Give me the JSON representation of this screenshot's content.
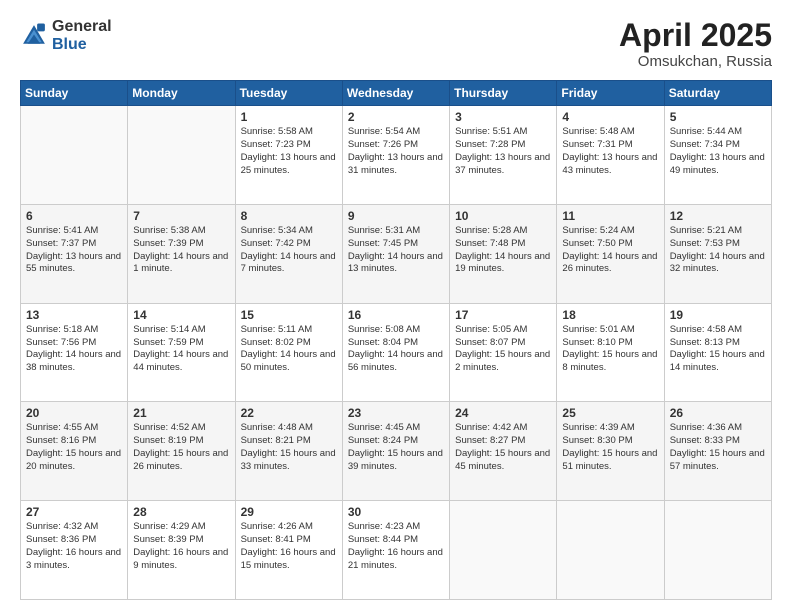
{
  "header": {
    "logo_general": "General",
    "logo_blue": "Blue",
    "title": "April 2025",
    "location": "Omsukchan, Russia"
  },
  "calendar": {
    "days_of_week": [
      "Sunday",
      "Monday",
      "Tuesday",
      "Wednesday",
      "Thursday",
      "Friday",
      "Saturday"
    ],
    "weeks": [
      [
        {
          "day": "",
          "info": ""
        },
        {
          "day": "",
          "info": ""
        },
        {
          "day": "1",
          "info": "Sunrise: 5:58 AM\nSunset: 7:23 PM\nDaylight: 13 hours and 25 minutes."
        },
        {
          "day": "2",
          "info": "Sunrise: 5:54 AM\nSunset: 7:26 PM\nDaylight: 13 hours and 31 minutes."
        },
        {
          "day": "3",
          "info": "Sunrise: 5:51 AM\nSunset: 7:28 PM\nDaylight: 13 hours and 37 minutes."
        },
        {
          "day": "4",
          "info": "Sunrise: 5:48 AM\nSunset: 7:31 PM\nDaylight: 13 hours and 43 minutes."
        },
        {
          "day": "5",
          "info": "Sunrise: 5:44 AM\nSunset: 7:34 PM\nDaylight: 13 hours and 49 minutes."
        }
      ],
      [
        {
          "day": "6",
          "info": "Sunrise: 5:41 AM\nSunset: 7:37 PM\nDaylight: 13 hours and 55 minutes."
        },
        {
          "day": "7",
          "info": "Sunrise: 5:38 AM\nSunset: 7:39 PM\nDaylight: 14 hours and 1 minute."
        },
        {
          "day": "8",
          "info": "Sunrise: 5:34 AM\nSunset: 7:42 PM\nDaylight: 14 hours and 7 minutes."
        },
        {
          "day": "9",
          "info": "Sunrise: 5:31 AM\nSunset: 7:45 PM\nDaylight: 14 hours and 13 minutes."
        },
        {
          "day": "10",
          "info": "Sunrise: 5:28 AM\nSunset: 7:48 PM\nDaylight: 14 hours and 19 minutes."
        },
        {
          "day": "11",
          "info": "Sunrise: 5:24 AM\nSunset: 7:50 PM\nDaylight: 14 hours and 26 minutes."
        },
        {
          "day": "12",
          "info": "Sunrise: 5:21 AM\nSunset: 7:53 PM\nDaylight: 14 hours and 32 minutes."
        }
      ],
      [
        {
          "day": "13",
          "info": "Sunrise: 5:18 AM\nSunset: 7:56 PM\nDaylight: 14 hours and 38 minutes."
        },
        {
          "day": "14",
          "info": "Sunrise: 5:14 AM\nSunset: 7:59 PM\nDaylight: 14 hours and 44 minutes."
        },
        {
          "day": "15",
          "info": "Sunrise: 5:11 AM\nSunset: 8:02 PM\nDaylight: 14 hours and 50 minutes."
        },
        {
          "day": "16",
          "info": "Sunrise: 5:08 AM\nSunset: 8:04 PM\nDaylight: 14 hours and 56 minutes."
        },
        {
          "day": "17",
          "info": "Sunrise: 5:05 AM\nSunset: 8:07 PM\nDaylight: 15 hours and 2 minutes."
        },
        {
          "day": "18",
          "info": "Sunrise: 5:01 AM\nSunset: 8:10 PM\nDaylight: 15 hours and 8 minutes."
        },
        {
          "day": "19",
          "info": "Sunrise: 4:58 AM\nSunset: 8:13 PM\nDaylight: 15 hours and 14 minutes."
        }
      ],
      [
        {
          "day": "20",
          "info": "Sunrise: 4:55 AM\nSunset: 8:16 PM\nDaylight: 15 hours and 20 minutes."
        },
        {
          "day": "21",
          "info": "Sunrise: 4:52 AM\nSunset: 8:19 PM\nDaylight: 15 hours and 26 minutes."
        },
        {
          "day": "22",
          "info": "Sunrise: 4:48 AM\nSunset: 8:21 PM\nDaylight: 15 hours and 33 minutes."
        },
        {
          "day": "23",
          "info": "Sunrise: 4:45 AM\nSunset: 8:24 PM\nDaylight: 15 hours and 39 minutes."
        },
        {
          "day": "24",
          "info": "Sunrise: 4:42 AM\nSunset: 8:27 PM\nDaylight: 15 hours and 45 minutes."
        },
        {
          "day": "25",
          "info": "Sunrise: 4:39 AM\nSunset: 8:30 PM\nDaylight: 15 hours and 51 minutes."
        },
        {
          "day": "26",
          "info": "Sunrise: 4:36 AM\nSunset: 8:33 PM\nDaylight: 15 hours and 57 minutes."
        }
      ],
      [
        {
          "day": "27",
          "info": "Sunrise: 4:32 AM\nSunset: 8:36 PM\nDaylight: 16 hours and 3 minutes."
        },
        {
          "day": "28",
          "info": "Sunrise: 4:29 AM\nSunset: 8:39 PM\nDaylight: 16 hours and 9 minutes."
        },
        {
          "day": "29",
          "info": "Sunrise: 4:26 AM\nSunset: 8:41 PM\nDaylight: 16 hours and 15 minutes."
        },
        {
          "day": "30",
          "info": "Sunrise: 4:23 AM\nSunset: 8:44 PM\nDaylight: 16 hours and 21 minutes."
        },
        {
          "day": "",
          "info": ""
        },
        {
          "day": "",
          "info": ""
        },
        {
          "day": "",
          "info": ""
        }
      ]
    ]
  }
}
